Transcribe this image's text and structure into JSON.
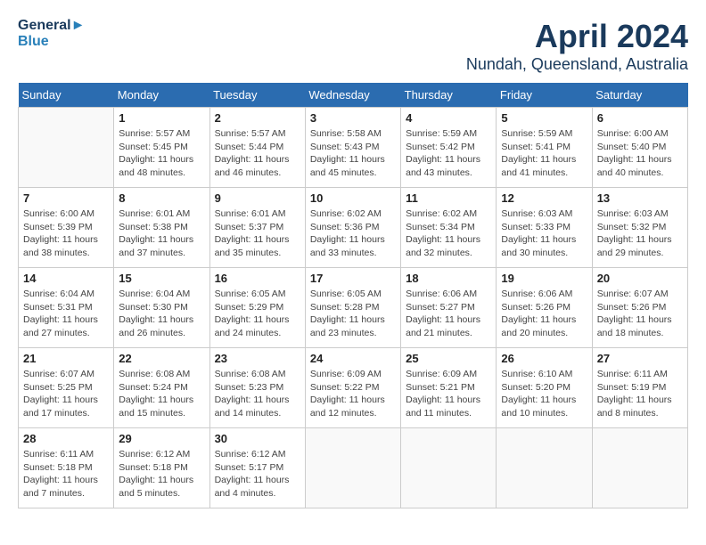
{
  "header": {
    "logo_line1": "General",
    "logo_line2": "Blue",
    "month": "April 2024",
    "location": "Nundah, Queensland, Australia"
  },
  "days_of_week": [
    "Sunday",
    "Monday",
    "Tuesday",
    "Wednesday",
    "Thursday",
    "Friday",
    "Saturday"
  ],
  "weeks": [
    [
      {
        "day": "",
        "info": ""
      },
      {
        "day": "1",
        "info": "Sunrise: 5:57 AM\nSunset: 5:45 PM\nDaylight: 11 hours\nand 48 minutes."
      },
      {
        "day": "2",
        "info": "Sunrise: 5:57 AM\nSunset: 5:44 PM\nDaylight: 11 hours\nand 46 minutes."
      },
      {
        "day": "3",
        "info": "Sunrise: 5:58 AM\nSunset: 5:43 PM\nDaylight: 11 hours\nand 45 minutes."
      },
      {
        "day": "4",
        "info": "Sunrise: 5:59 AM\nSunset: 5:42 PM\nDaylight: 11 hours\nand 43 minutes."
      },
      {
        "day": "5",
        "info": "Sunrise: 5:59 AM\nSunset: 5:41 PM\nDaylight: 11 hours\nand 41 minutes."
      },
      {
        "day": "6",
        "info": "Sunrise: 6:00 AM\nSunset: 5:40 PM\nDaylight: 11 hours\nand 40 minutes."
      }
    ],
    [
      {
        "day": "7",
        "info": "Sunrise: 6:00 AM\nSunset: 5:39 PM\nDaylight: 11 hours\nand 38 minutes."
      },
      {
        "day": "8",
        "info": "Sunrise: 6:01 AM\nSunset: 5:38 PM\nDaylight: 11 hours\nand 37 minutes."
      },
      {
        "day": "9",
        "info": "Sunrise: 6:01 AM\nSunset: 5:37 PM\nDaylight: 11 hours\nand 35 minutes."
      },
      {
        "day": "10",
        "info": "Sunrise: 6:02 AM\nSunset: 5:36 PM\nDaylight: 11 hours\nand 33 minutes."
      },
      {
        "day": "11",
        "info": "Sunrise: 6:02 AM\nSunset: 5:34 PM\nDaylight: 11 hours\nand 32 minutes."
      },
      {
        "day": "12",
        "info": "Sunrise: 6:03 AM\nSunset: 5:33 PM\nDaylight: 11 hours\nand 30 minutes."
      },
      {
        "day": "13",
        "info": "Sunrise: 6:03 AM\nSunset: 5:32 PM\nDaylight: 11 hours\nand 29 minutes."
      }
    ],
    [
      {
        "day": "14",
        "info": "Sunrise: 6:04 AM\nSunset: 5:31 PM\nDaylight: 11 hours\nand 27 minutes."
      },
      {
        "day": "15",
        "info": "Sunrise: 6:04 AM\nSunset: 5:30 PM\nDaylight: 11 hours\nand 26 minutes."
      },
      {
        "day": "16",
        "info": "Sunrise: 6:05 AM\nSunset: 5:29 PM\nDaylight: 11 hours\nand 24 minutes."
      },
      {
        "day": "17",
        "info": "Sunrise: 6:05 AM\nSunset: 5:28 PM\nDaylight: 11 hours\nand 23 minutes."
      },
      {
        "day": "18",
        "info": "Sunrise: 6:06 AM\nSunset: 5:27 PM\nDaylight: 11 hours\nand 21 minutes."
      },
      {
        "day": "19",
        "info": "Sunrise: 6:06 AM\nSunset: 5:26 PM\nDaylight: 11 hours\nand 20 minutes."
      },
      {
        "day": "20",
        "info": "Sunrise: 6:07 AM\nSunset: 5:26 PM\nDaylight: 11 hours\nand 18 minutes."
      }
    ],
    [
      {
        "day": "21",
        "info": "Sunrise: 6:07 AM\nSunset: 5:25 PM\nDaylight: 11 hours\nand 17 minutes."
      },
      {
        "day": "22",
        "info": "Sunrise: 6:08 AM\nSunset: 5:24 PM\nDaylight: 11 hours\nand 15 minutes."
      },
      {
        "day": "23",
        "info": "Sunrise: 6:08 AM\nSunset: 5:23 PM\nDaylight: 11 hours\nand 14 minutes."
      },
      {
        "day": "24",
        "info": "Sunrise: 6:09 AM\nSunset: 5:22 PM\nDaylight: 11 hours\nand 12 minutes."
      },
      {
        "day": "25",
        "info": "Sunrise: 6:09 AM\nSunset: 5:21 PM\nDaylight: 11 hours\nand 11 minutes."
      },
      {
        "day": "26",
        "info": "Sunrise: 6:10 AM\nSunset: 5:20 PM\nDaylight: 11 hours\nand 10 minutes."
      },
      {
        "day": "27",
        "info": "Sunrise: 6:11 AM\nSunset: 5:19 PM\nDaylight: 11 hours\nand 8 minutes."
      }
    ],
    [
      {
        "day": "28",
        "info": "Sunrise: 6:11 AM\nSunset: 5:18 PM\nDaylight: 11 hours\nand 7 minutes."
      },
      {
        "day": "29",
        "info": "Sunrise: 6:12 AM\nSunset: 5:18 PM\nDaylight: 11 hours\nand 5 minutes."
      },
      {
        "day": "30",
        "info": "Sunrise: 6:12 AM\nSunset: 5:17 PM\nDaylight: 11 hours\nand 4 minutes."
      },
      {
        "day": "",
        "info": ""
      },
      {
        "day": "",
        "info": ""
      },
      {
        "day": "",
        "info": ""
      },
      {
        "day": "",
        "info": ""
      }
    ]
  ]
}
